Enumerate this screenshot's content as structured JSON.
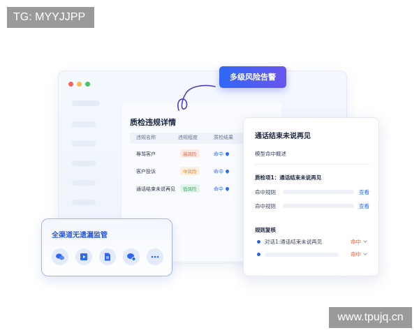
{
  "watermarks": {
    "top_left": "TG: MYYJJPP",
    "bottom_right": "www.tpujq.cn"
  },
  "alert_button": {
    "label": "多级风险告警"
  },
  "violations": {
    "title": "质检违规详情",
    "columns": [
      "违规名称",
      "违规程度",
      "质检结果"
    ],
    "rows": [
      {
        "name": "辱骂客户",
        "level": "高风险",
        "level_color": "#e8613a",
        "level_bg": "#fde9e2",
        "result": "命中"
      },
      {
        "name": "客户投诉",
        "level": "中风险",
        "level_color": "#e8813a",
        "level_bg": "#fdeedd",
        "result": "命中"
      },
      {
        "name": "通话结束未说再见",
        "level": "低风险",
        "level_color": "#3aa66a",
        "level_bg": "#e2f5ea",
        "result": "命中"
      }
    ]
  },
  "detail": {
    "title": "通话结束未说再见",
    "overview": "模型命中概述",
    "item_title": "质检项1：通话结束未说再见",
    "rules": [
      {
        "label": "命中规则",
        "link": "查看"
      },
      {
        "label": "命中规则",
        "link": "查看"
      }
    ],
    "review_title": "规则复核",
    "review_items": [
      {
        "text": "对话1:通话结束未说再见",
        "result": "命中"
      },
      {
        "text": "",
        "result": "命中"
      }
    ]
  },
  "channel": {
    "title": "全渠道无遗漏监管",
    "icons": [
      "chat-bubbles-icon",
      "video-icon",
      "document-icon",
      "message-check-icon",
      "more-icon"
    ]
  },
  "colors": {
    "accent": "#2a6ef3",
    "danger": "#e8613a",
    "brand_gradient_start": "#2f67f6",
    "brand_gradient_end": "#6a55ee"
  }
}
